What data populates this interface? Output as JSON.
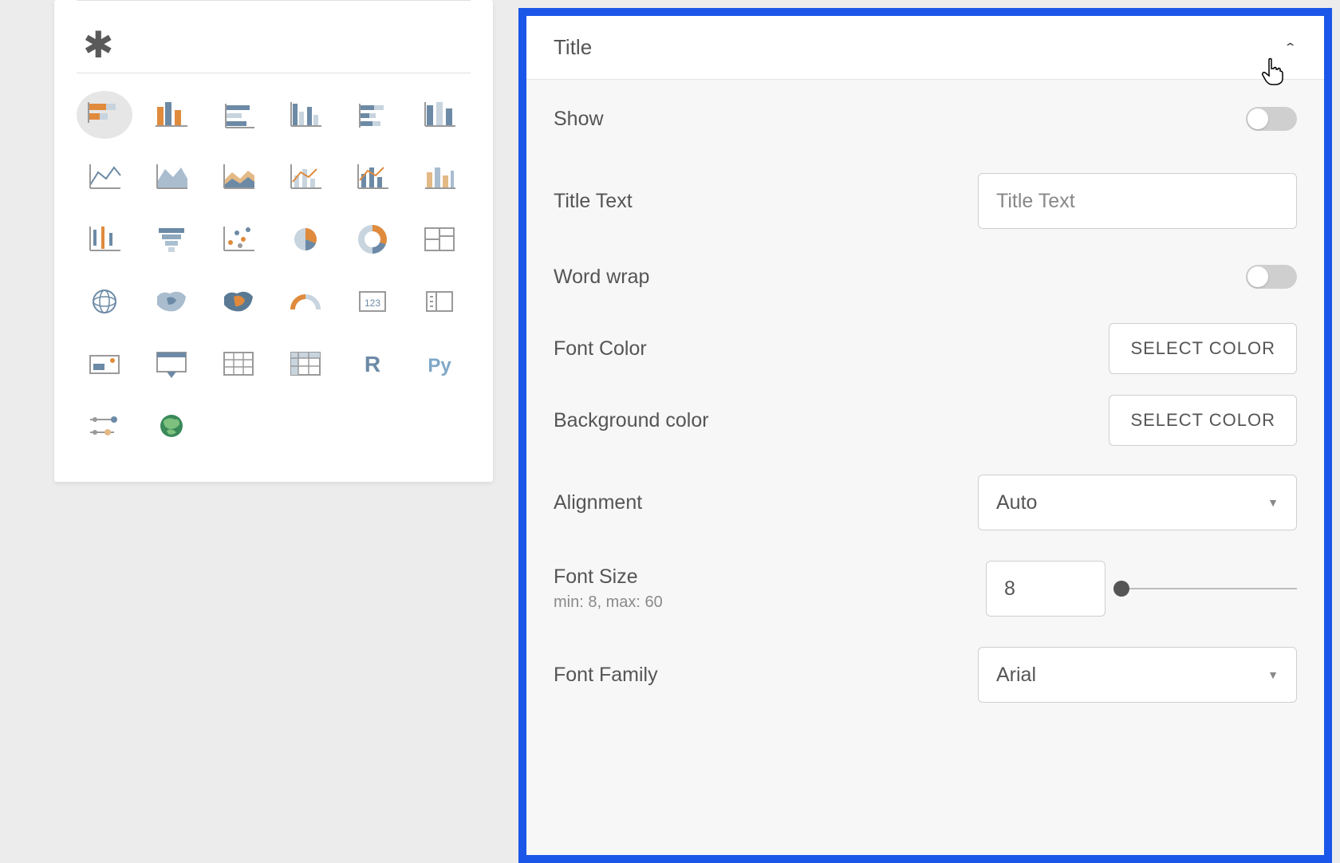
{
  "viz_palette": {
    "types": [
      "stacked-h-bar",
      "clustered-bar",
      "stacked-bar-alt",
      "clustered-bar-alt",
      "stacked-h-bar-2",
      "clustered-column-alt",
      "line-chart",
      "area-chart",
      "stacked-area",
      "line-multi",
      "column-line",
      "column-area",
      "range-column",
      "funnel",
      "scatter",
      "pie",
      "donut",
      "treemap",
      "globe",
      "map-heat",
      "map-choropleth",
      "gauge",
      "kpi",
      "card",
      "slicer",
      "slicer-table",
      "table",
      "matrix",
      "r-visual",
      "py-visual",
      "key-influencers",
      "arcgis"
    ]
  },
  "properties": {
    "section_label": "Title",
    "fields": {
      "show_label": "Show",
      "title_text_label": "Title Text",
      "title_text_placeholder": "Title Text",
      "word_wrap_label": "Word wrap",
      "font_color_label": "Font Color",
      "font_color_button": "SELECT COLOR",
      "bg_color_label": "Background color",
      "bg_color_button": "SELECT COLOR",
      "alignment_label": "Alignment",
      "alignment_value": "Auto",
      "font_size_label": "Font Size",
      "font_size_hint": "min: 8, max: 60",
      "font_size_value": "8",
      "font_family_label": "Font Family",
      "font_family_value": "Arial"
    }
  },
  "colors": {
    "orange": "#e08a3c",
    "steel": "#6c8aa6",
    "light": "#c8d4de",
    "grey": "#9a9a9a",
    "axis": "#9a9a9a"
  }
}
